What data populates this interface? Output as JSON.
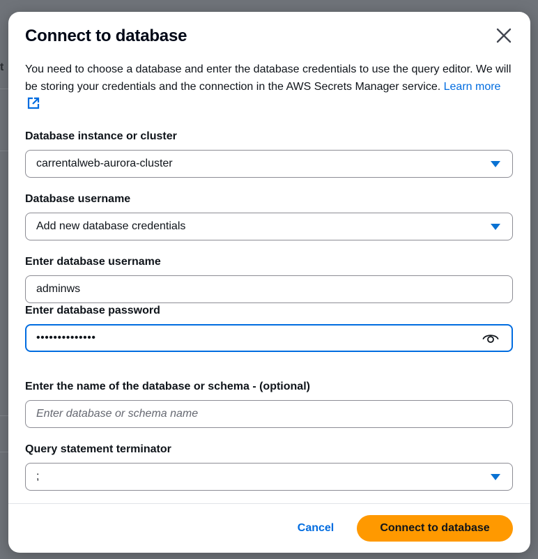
{
  "background": {
    "glyph": "t"
  },
  "dialog": {
    "title": "Connect to database",
    "description": "You need to choose a database and enter the database credentials to use the query editor. We will be storing your credentials and the connection in the AWS Secrets Manager service.",
    "learn_more_label": "Learn more",
    "close_icon": "close-icon"
  },
  "fields": {
    "instance": {
      "label": "Database instance or cluster",
      "value": "carrentalweb-aurora-cluster"
    },
    "username_select": {
      "label": "Database username",
      "value": "Add new database credentials"
    },
    "username_input": {
      "label": "Enter database username",
      "value": "adminws"
    },
    "password": {
      "label": "Enter database password",
      "value": "••••••••••••••",
      "icon": "eye-icon"
    },
    "schema": {
      "label": "Enter the name of the database or schema - (optional)",
      "placeholder": "Enter database or schema name",
      "value": ""
    },
    "terminator": {
      "label": "Query statement terminator",
      "value": ";"
    }
  },
  "footer": {
    "cancel_label": "Cancel",
    "connect_label": "Connect to database"
  },
  "colors": {
    "accent": "#006ce0",
    "primary_button": "#ff9900",
    "backdrop": "#6b6f76"
  }
}
